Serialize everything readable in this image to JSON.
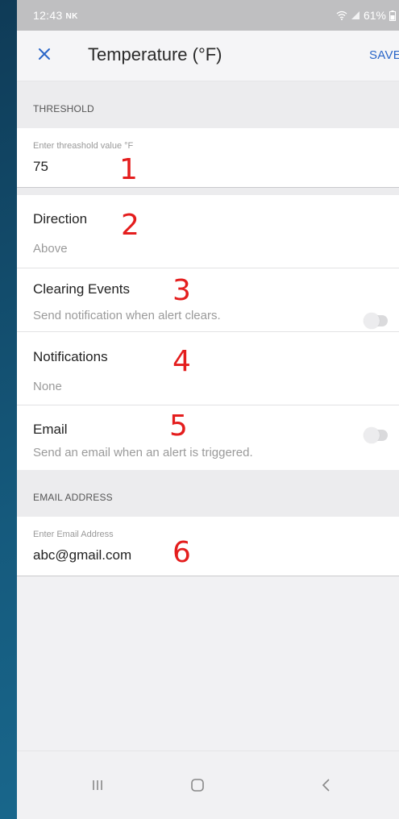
{
  "status_bar": {
    "time": "12:43",
    "carrier": "NK",
    "battery": "61%"
  },
  "app_bar": {
    "title": "Temperature (°F)",
    "save_label": "SAVE"
  },
  "threshold_section": {
    "header": "THRESHOLD",
    "field_label": "Enter threashold value °F",
    "field_value": "75"
  },
  "settings": {
    "direction": {
      "title": "Direction",
      "value": "Above"
    },
    "clearing_events": {
      "title": "Clearing Events",
      "subtitle": "Send notification when alert clears.",
      "enabled": false
    },
    "notifications": {
      "title": "Notifications",
      "value": "None"
    },
    "email": {
      "title": "Email",
      "subtitle": "Send an email when an alert is triggered.",
      "enabled": false
    }
  },
  "email_section": {
    "header": "EMAIL ADDRESS",
    "field_label": "Enter Email Address",
    "field_value": "abc@gmail.com"
  },
  "annotations": [
    "1",
    "2",
    "3",
    "4",
    "5",
    "6"
  ],
  "colors": {
    "accent": "#2a66c8",
    "annotation": "#e41d1d",
    "background": "#f1f1f3"
  }
}
